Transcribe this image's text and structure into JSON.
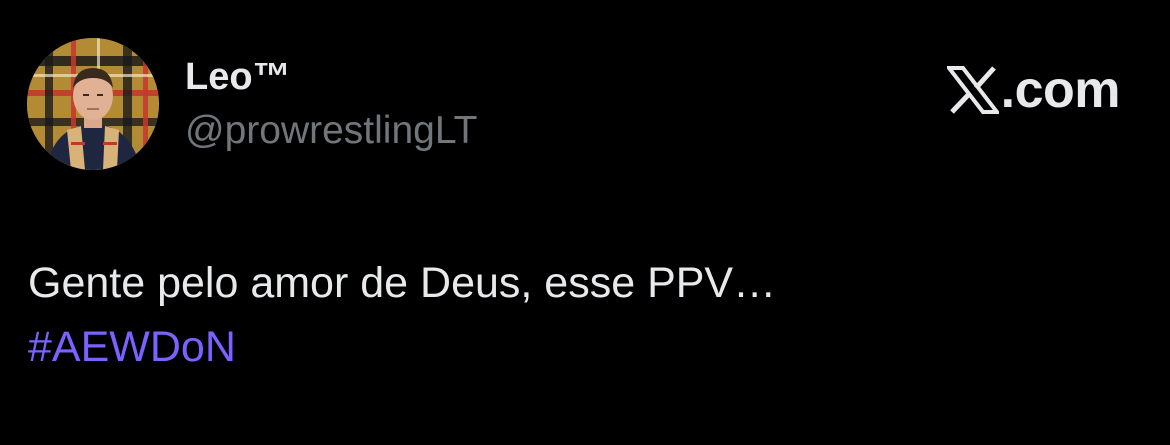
{
  "author": {
    "display_name": "Leo™",
    "handle": "@prowrestlingLT",
    "avatar_icon": "profile-photo"
  },
  "brand": {
    "icon": "x-logo-icon",
    "domain_text": ".com"
  },
  "tweet": {
    "text": "Gente pelo amor de Deus, esse PPV…",
    "hashtag": "#AEWDoN"
  },
  "colors": {
    "background": "#000000",
    "primary_text": "#e7e9ea",
    "secondary_text": "#71767b",
    "hashtag": "#7b61ff"
  }
}
